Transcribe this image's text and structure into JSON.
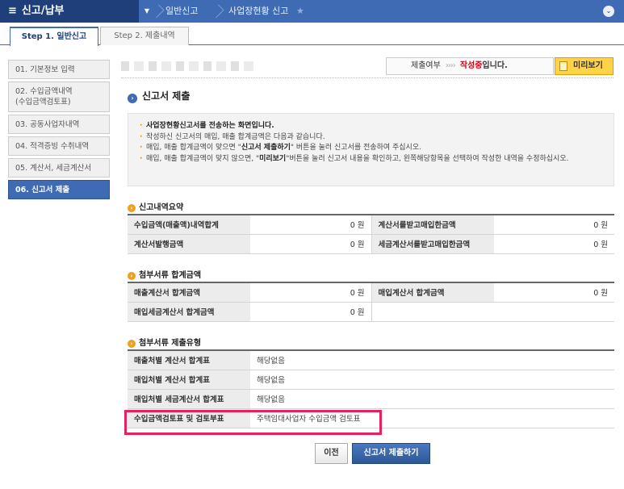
{
  "topnav": {
    "menu_title": "신고/납부",
    "menu_icon": "hamburger-icon",
    "crumb1": "일반신고",
    "crumb2": "사업장현황 신고",
    "star_icon": "★",
    "expand_icon": "chevron-down-icon"
  },
  "tabs": [
    {
      "label": "Step 1. 일반신고",
      "active": true
    },
    {
      "label": "Step 2. 제출내역",
      "active": false
    }
  ],
  "sidebar": {
    "items": [
      {
        "label": "01. 기본정보 입력"
      },
      {
        "label": "02. 수입금액내역\n(수입금액검토표)"
      },
      {
        "label": "03. 공동사업자내역"
      },
      {
        "label": "04. 적격증빙 수취내역"
      },
      {
        "label": "05. 계산서, 세금계산서"
      },
      {
        "label": "06. 신고서 제출",
        "active": true
      }
    ]
  },
  "status": {
    "label": "제출여부",
    "arrows": "››››",
    "state": "작성중",
    "suffix": "입니다.",
    "preview_button": "미리보기"
  },
  "section_title": "신고서 제출",
  "notice": {
    "line1": "사업장현황신고서를 전송하는 화면입니다.",
    "line2": "작성하신 신고서의 매입, 매출 합계금액은 다음과 같습니다.",
    "line3_a": "매입, 매출 합계금액이 맞으면 \"",
    "line3_b": "신고서 제출하기",
    "line3_c": "\" 버튼을 눌러 신고서를 전송하여 주십시오.",
    "line4_a": "매입, 매출 합계금액이 맞지 않으면, \"",
    "line4_b": "미리보기",
    "line4_c": "\"버튼을 눌러 신고서 내용을 확인하고, 왼쪽해당항목을 선택하여 작성한 내역을 수정하십시오."
  },
  "summary": {
    "title": "신고내역요약",
    "rows": [
      {
        "l1": "수입금액(매출액)내역합계",
        "v1": "0 원",
        "l2": "계산서를받고매입한금액",
        "v2": "0 원"
      },
      {
        "l1": "계산서발행금액",
        "v1": "0 원",
        "l2": "세금계산서를받고매입한금액",
        "v2": "0 원"
      }
    ]
  },
  "attach_total": {
    "title": "첨부서류 합계금액",
    "rows": [
      {
        "l1": "매출계산서 합계금액",
        "v1": "0 원",
        "l2": "매입계산서  합계금액",
        "v2": "0 원"
      },
      {
        "l1": "매입세금계산서 합계금액",
        "v1": "0 원",
        "l2": "",
        "v2": ""
      }
    ]
  },
  "attach_type": {
    "title": "첨부서류 제출유형",
    "rows": [
      {
        "label": "매출처별 계산서 합계표",
        "value": "해당없음"
      },
      {
        "label": "매입처별 계산서 합계표",
        "value": "해당없음"
      },
      {
        "label": "매입처별 세금계산서 합계표",
        "value": "해당없음"
      },
      {
        "label": "수입금액검토표 및 검토부표",
        "value": "주택임대사업자 수입금액 검토표"
      }
    ]
  },
  "buttons": {
    "prev": "이전",
    "submit": "신고서 제출하기"
  }
}
